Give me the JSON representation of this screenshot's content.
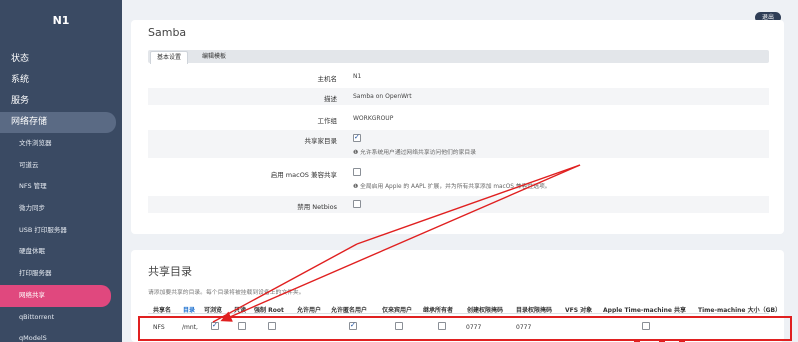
{
  "sidebar": {
    "brand": "N1",
    "items": [
      {
        "label": "状态"
      },
      {
        "label": "系统"
      },
      {
        "label": "服务"
      },
      {
        "label": "网络存储"
      },
      {
        "label": "文件浏览器"
      },
      {
        "label": "可道云"
      },
      {
        "label": "NFS 管理"
      },
      {
        "label": "微力同步"
      },
      {
        "label": "USB 打印服务器"
      },
      {
        "label": "硬盘休眠"
      },
      {
        "label": "打印服务器"
      },
      {
        "label": "网络共享"
      },
      {
        "label": "qBittorrent"
      },
      {
        "label": "qModelS"
      }
    ]
  },
  "header": {
    "logout_label": "退出"
  },
  "samba": {
    "title": "Samba",
    "tabs": [
      {
        "label": "基本设置"
      },
      {
        "label": "编辑模板"
      }
    ],
    "fields": {
      "hostname": {
        "label": "主机名",
        "value": "N1"
      },
      "description": {
        "label": "描述",
        "value": "Samba on OpenWrt"
      },
      "workgroup": {
        "label": "工作组",
        "value": "WORKGROUP"
      },
      "share_home": {
        "label": "共享家目录",
        "checked": true,
        "desc": "允许系统用户通过网络共享访问他们的家目录"
      },
      "macos": {
        "label": "启用 macOS 兼容共享",
        "checked": false,
        "desc": "全局启用 Apple 的 AAPL 扩展，并为所有共享添加 macOS 兼容性选项。"
      },
      "netbios": {
        "label": "禁用 Netbios",
        "checked": false
      }
    }
  },
  "shares": {
    "title": "共享目录",
    "note": "请添加要共享的目录。每个目录将被挂载到设备上的文件夹。",
    "headers": [
      "共享名",
      "目录",
      "可浏览",
      "只读",
      "强制 Root",
      "允许用户",
      "允许匿名用户",
      "仅来宾用户",
      "继承所有者",
      "创建权限掩码",
      "目录权限掩码",
      "VFS 对象",
      "Apple Time-machine 共享",
      "Time-machine 大小（GB）"
    ],
    "row": {
      "name": "NFS",
      "path": "/mnt,",
      "browseable": true,
      "read_only": false,
      "force_root": false,
      "allow_guest": true,
      "guest_only": false,
      "inherit_owner": false,
      "create_mask": "0777",
      "dir_mask": "0777",
      "timemachine": false
    }
  },
  "colors": {
    "accent": "#e0487e",
    "sidebar": "#3a4a63",
    "annotation": "#e02020"
  }
}
